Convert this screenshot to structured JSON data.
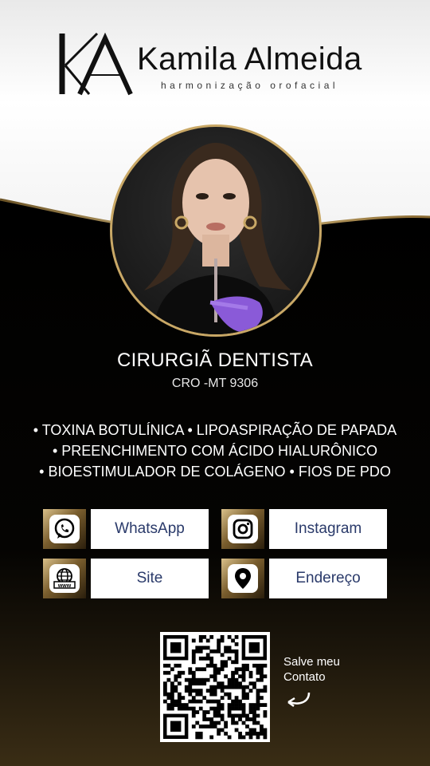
{
  "brand": {
    "monogram": "KA",
    "name": "Kamila Almeida",
    "subtitle": "harmonização orofacial"
  },
  "profile": {
    "role": "CIRURGIÃ DENTISTA",
    "registration": "CRO -MT 9306"
  },
  "services": [
    "• TOXINA BOTULÍNICA • LIPOASPIRAÇÃO DE PAPADA",
    "• PREENCHIMENTO COM ÁCIDO HIALURÔNICO",
    "• BIOESTIMULADOR DE COLÁGENO  • FIOS DE PDO"
  ],
  "buttons": [
    {
      "label": "WhatsApp",
      "icon": "whatsapp-icon"
    },
    {
      "label": "Instagram",
      "icon": "instagram-icon"
    },
    {
      "label": "Site",
      "icon": "globe-www-icon"
    },
    {
      "label": "Endereço",
      "icon": "location-pin-icon"
    }
  ],
  "qr": {
    "caption_line1": "Salve meu",
    "caption_line2": "Contato"
  },
  "colors": {
    "gold": "#c9a866",
    "button_text": "#2a3a6a",
    "background_dark": "#000000"
  }
}
